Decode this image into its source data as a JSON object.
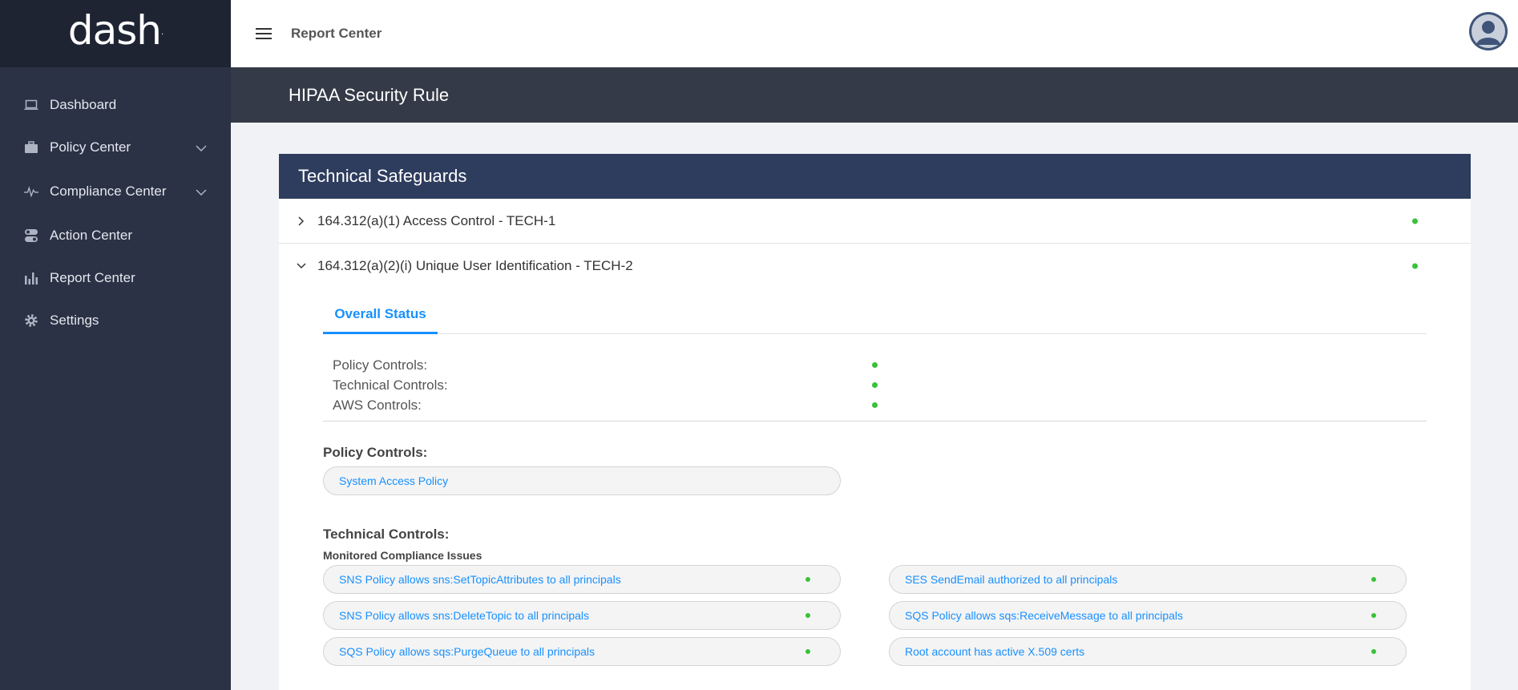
{
  "app": {
    "logo_text": "dash",
    "logo_mark": "."
  },
  "sidebar": {
    "items": [
      {
        "label": "Dashboard",
        "icon": "laptop-icon",
        "has_dropdown": false
      },
      {
        "label": "Policy Center",
        "icon": "briefcase-icon",
        "has_dropdown": true
      },
      {
        "label": "Compliance Center",
        "icon": "pulse-icon",
        "has_dropdown": true
      },
      {
        "label": "Action Center",
        "icon": "toggle-icon",
        "has_dropdown": false
      },
      {
        "label": "Report Center",
        "icon": "bar-chart-icon",
        "has_dropdown": false
      },
      {
        "label": "Settings",
        "icon": "gear-icon",
        "has_dropdown": false
      }
    ]
  },
  "topbar": {
    "title": "Report Center",
    "menu_icon": "hamburger-icon",
    "avatar_icon": "user-avatar-icon"
  },
  "page": {
    "title": "HIPAA Security Rule"
  },
  "card": {
    "title": "Technical Safeguards",
    "rows": [
      {
        "label": "164.312(a)(1) Access Control - TECH-1",
        "expanded": false,
        "status": "green"
      },
      {
        "label": "164.312(a)(2)(i) Unique User Identification - TECH-2",
        "expanded": true,
        "status": "green"
      }
    ],
    "tab_label": "Overall Status",
    "overall": [
      {
        "label": "Policy Controls:",
        "status": "green"
      },
      {
        "label": "Technical Controls:",
        "status": "green"
      },
      {
        "label": "AWS Controls:",
        "status": "green"
      }
    ],
    "policy_controls_title": "Policy Controls:",
    "policy_controls": [
      {
        "label": "System Access Policy"
      }
    ],
    "technical_controls_title": "Technical Controls:",
    "monitored_title": "Monitored Compliance Issues",
    "issues_left": [
      {
        "label": "SNS Policy allows sns:SetTopicAttributes to all principals",
        "status": "green"
      },
      {
        "label": "SNS Policy allows sns:DeleteTopic to all principals",
        "status": "green"
      },
      {
        "label": "SQS Policy allows sqs:PurgeQueue to all principals",
        "status": "green"
      }
    ],
    "issues_right": [
      {
        "label": "SES SendEmail authorized to all principals",
        "status": "green"
      },
      {
        "label": "SQS Policy allows sqs:ReceiveMessage to all principals",
        "status": "green"
      },
      {
        "label": "Root account has active X.509 certs",
        "status": "green"
      }
    ]
  },
  "colors": {
    "sidebar_bg": "#2b3245",
    "logo_bg": "#1f2433",
    "header_bg": "#343a47",
    "card_head_bg": "#2e3d5e",
    "accent": "#1890ff",
    "status_green": "#38c238"
  }
}
